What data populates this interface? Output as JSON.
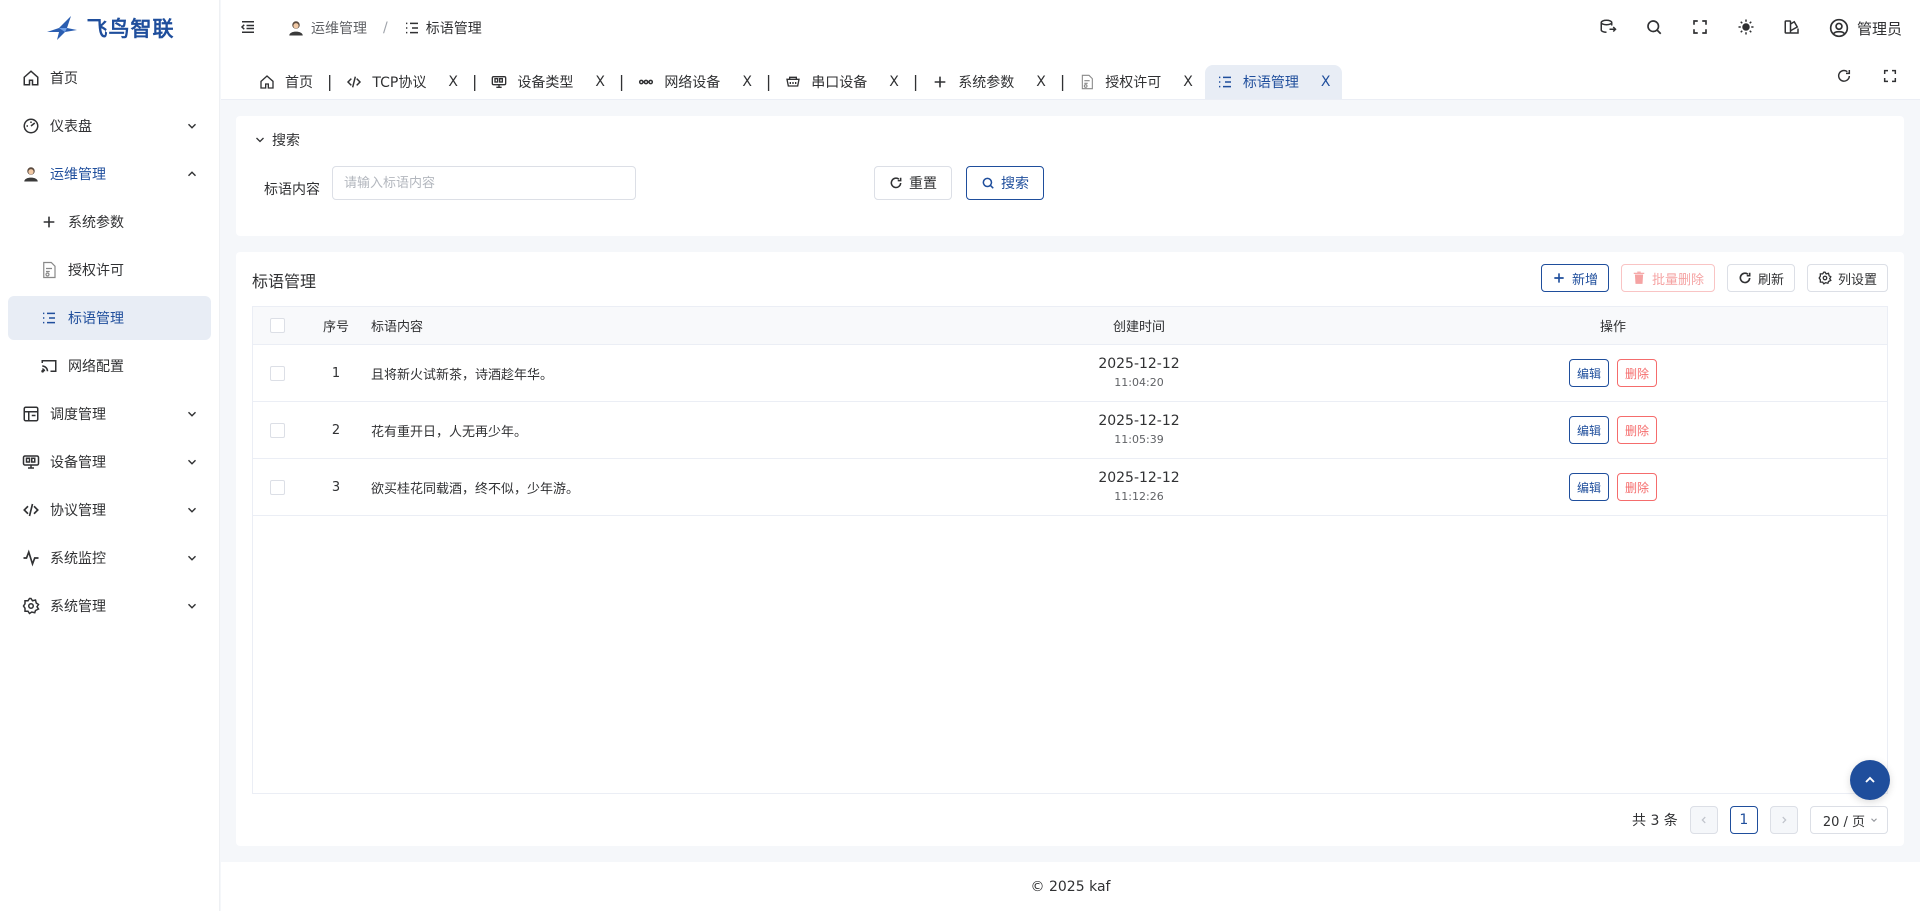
{
  "app": {
    "name": "飞鸟智联"
  },
  "sidebar": {
    "items": [
      {
        "label": "首页",
        "icon": "home-icon"
      },
      {
        "label": "仪表盘",
        "icon": "dashboard-icon"
      },
      {
        "label": "运维管理",
        "icon": "avatar-icon"
      },
      {
        "label": "系统参数",
        "icon": "plus-icon"
      },
      {
        "label": "授权许可",
        "icon": "license-icon"
      },
      {
        "label": "标语管理",
        "icon": "list-indent-icon"
      },
      {
        "label": "网络配置",
        "icon": "cast-icon"
      },
      {
        "label": "调度管理",
        "icon": "schedule-icon"
      },
      {
        "label": "设备管理",
        "icon": "device-icon"
      },
      {
        "label": "协议管理",
        "icon": "code-icon"
      },
      {
        "label": "系统监控",
        "icon": "pulse-icon"
      },
      {
        "label": "系统管理",
        "icon": "gear-icon"
      }
    ]
  },
  "header": {
    "breadcrumb": [
      "运维管理",
      "/",
      "标语管理"
    ],
    "user": "管理员"
  },
  "tabs": [
    {
      "label": "首页"
    },
    {
      "label": "TCP协议",
      "close": "X"
    },
    {
      "label": "设备类型",
      "close": "X"
    },
    {
      "label": "网络设备",
      "close": "X"
    },
    {
      "label": "串口设备",
      "close": "X"
    },
    {
      "label": "系统参数",
      "close": "X"
    },
    {
      "label": "授权许可",
      "close": "X"
    },
    {
      "label": "标语管理",
      "close": "X"
    }
  ],
  "tab_separator": "|",
  "search": {
    "title": "搜索",
    "label": "标语内容",
    "placeholder": "请输入标语内容",
    "value": "",
    "reset_label": "重置",
    "search_label": "搜索"
  },
  "table": {
    "title": "标语管理",
    "toolbar": {
      "add": "新增",
      "batch_delete": "批量删除",
      "refresh": "刷新",
      "columns": "列设置"
    },
    "headers": {
      "no": "序号",
      "content": "标语内容",
      "time": "创建时间",
      "op": "操作"
    },
    "rows": [
      {
        "no": "1",
        "content": "且将新火试新茶，诗酒趁年华。",
        "date": "2025-12-12",
        "time": "11:04:20",
        "edit": "编辑",
        "delete": "删除"
      },
      {
        "no": "2",
        "content": "花有重开日，人无再少年。",
        "date": "2025-12-12",
        "time": "11:05:39",
        "edit": "编辑",
        "delete": "删除"
      },
      {
        "no": "3",
        "content": "欲买桂花同载酒，终不似，少年游。",
        "date": "2025-12-12",
        "time": "11:12:26",
        "edit": "编辑",
        "delete": "删除"
      }
    ]
  },
  "pagination": {
    "total": "共 3 条",
    "current": "1",
    "page_size": "20 / 页"
  },
  "footer": {
    "text": "© 2025 kaf"
  },
  "colors": {
    "primary": "#1f4e9c",
    "danger": "#f56c6c"
  }
}
